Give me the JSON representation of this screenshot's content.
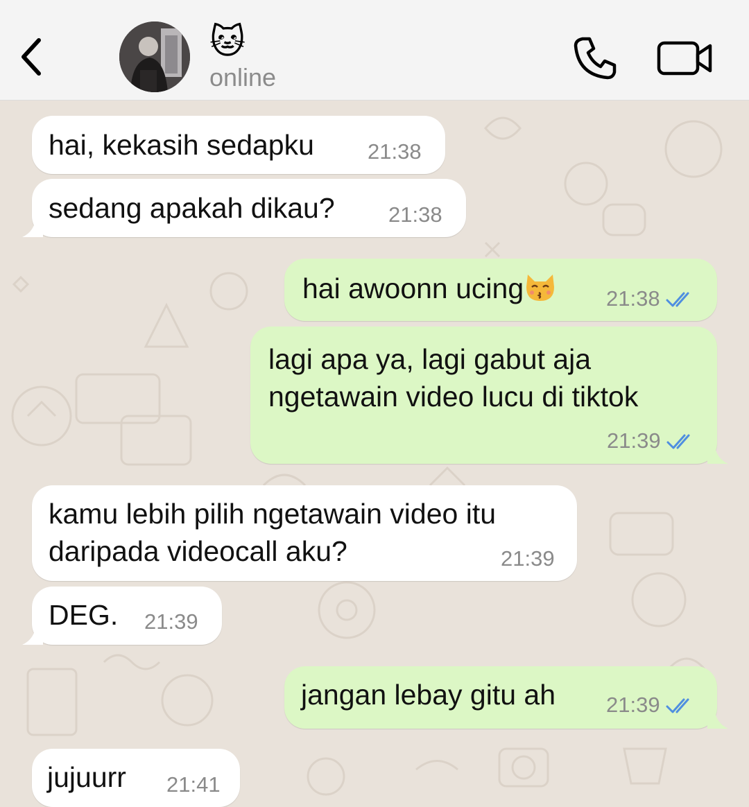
{
  "header": {
    "contact_name": "🐱",
    "status": "online"
  },
  "messages": [
    {
      "direction": "incoming",
      "text": "hai, kekasih sedapku",
      "time": "21:38"
    },
    {
      "direction": "incoming",
      "text": "sedang apakah dikau?",
      "time": "21:38"
    },
    {
      "direction": "outgoing",
      "text": "hai awoonn ucing",
      "emoji": "kissing-cat",
      "time": "21:38",
      "read": true
    },
    {
      "direction": "outgoing",
      "lines": [
        "lagi apa ya, lagi gabut aja",
        "ngetawain video lucu di tiktok"
      ],
      "time": "21:39",
      "read": true
    },
    {
      "direction": "incoming",
      "lines": [
        "kamu lebih pilih ngetawain video itu",
        "daripada videocall aku?"
      ],
      "time": "21:39"
    },
    {
      "direction": "incoming",
      "text": "DEG.",
      "time": "21:39"
    },
    {
      "direction": "outgoing",
      "text": "jangan lebay gitu ah",
      "time": "21:39",
      "read": true
    },
    {
      "direction": "incoming",
      "text": "jujuurr",
      "time": "21:41"
    }
  ],
  "icons": {
    "back": "chevron-left-icon",
    "call": "phone-icon",
    "video": "video-camera-icon",
    "read_receipt": "double-check-icon"
  },
  "colors": {
    "incoming_bubble": "#ffffff",
    "outgoing_bubble": "#dcf7c5",
    "read_ticks": "#4f8fe0",
    "chat_background": "#e9e2da",
    "header_background": "#f4f4f4"
  }
}
